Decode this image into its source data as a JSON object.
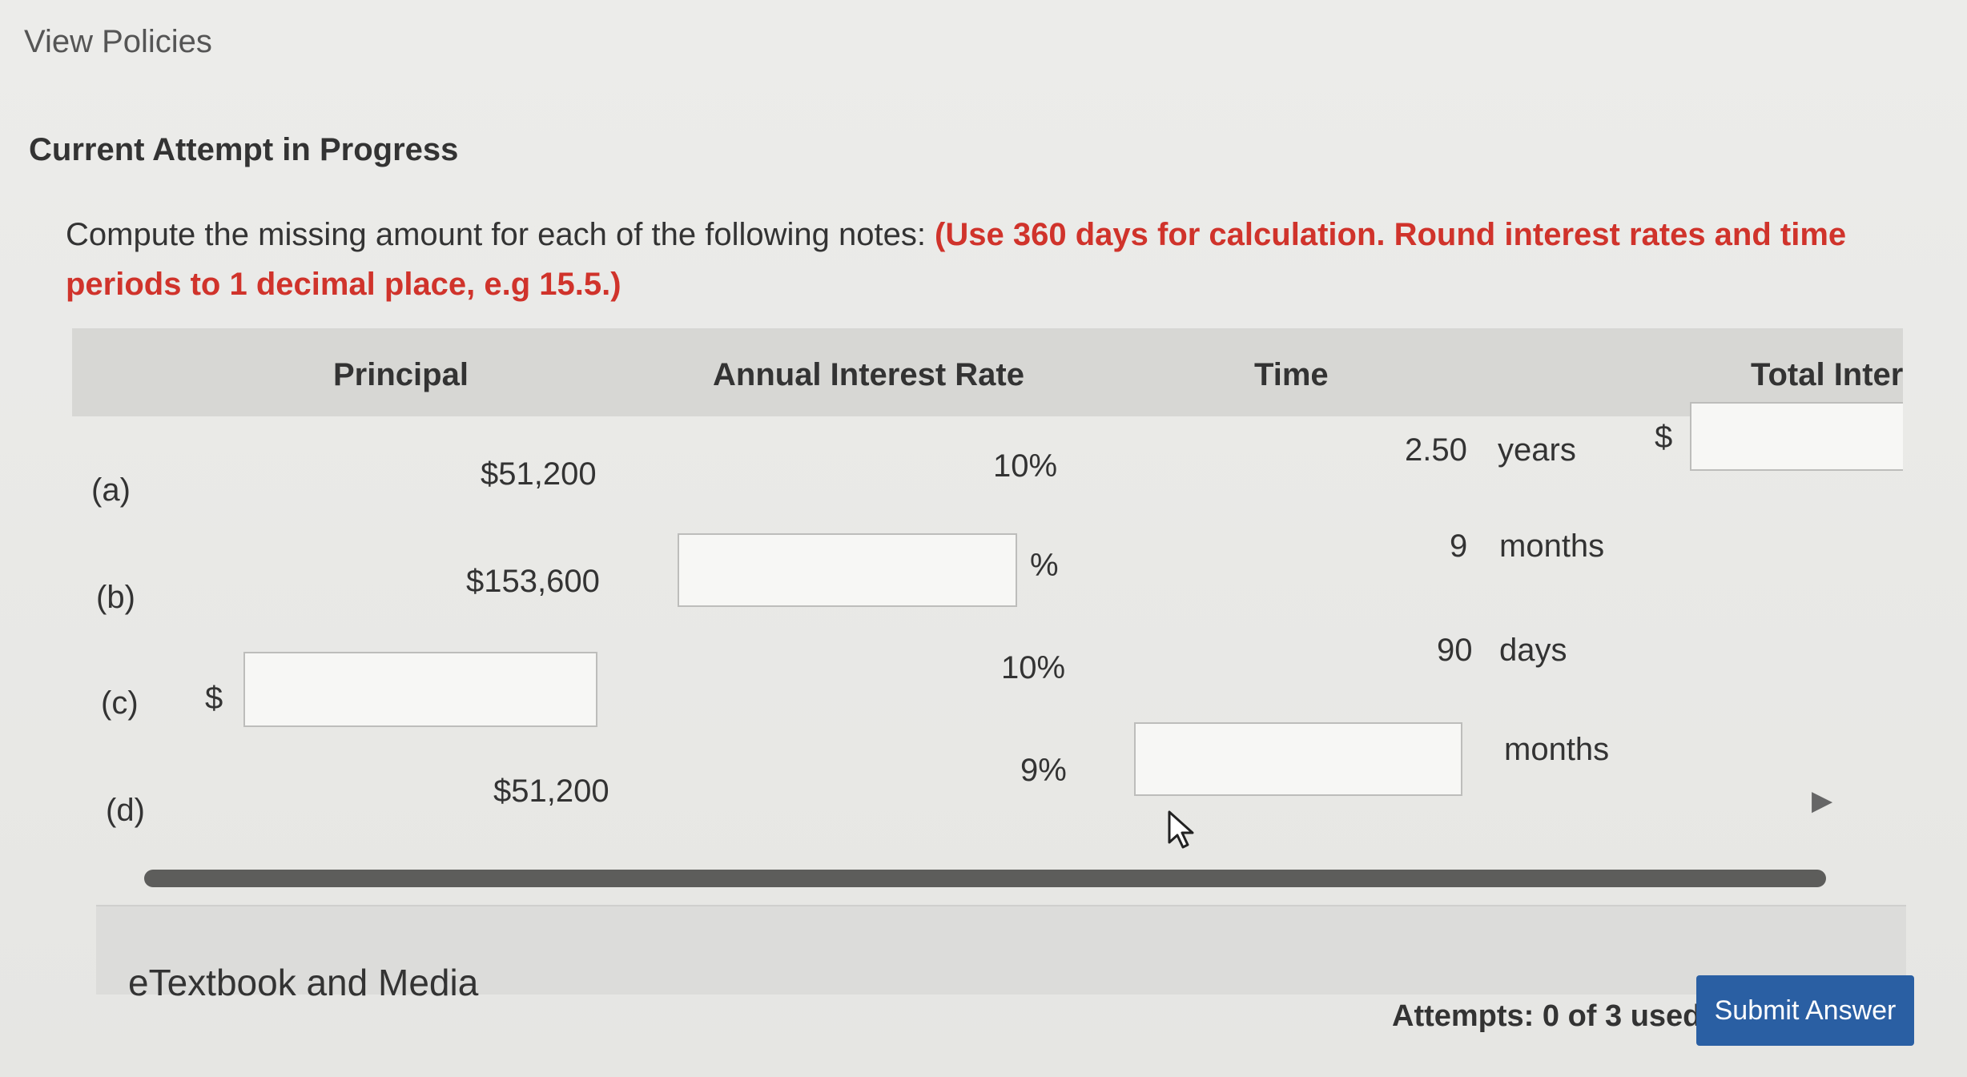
{
  "nav": {
    "view_policies": "View Policies"
  },
  "attempt": {
    "heading": "Current Attempt in Progress"
  },
  "question": {
    "prompt": "Compute the missing amount for each of the following notes: ",
    "note": "(Use 360 days for calculation. Round interest rates and time periods to 1 decimal place, e.g 15.5.)"
  },
  "table": {
    "headers": {
      "principal": "Principal",
      "rate": "Annual Interest Rate",
      "time": "Time",
      "total": "Total Intere"
    },
    "rows": [
      {
        "label": "(a)",
        "principal": "$51,200",
        "rate": "10%",
        "time": "2.50",
        "time_unit": "years",
        "total_prefix": "$"
      },
      {
        "label": "(b)",
        "principal": "$153,600",
        "rate_suffix": "%",
        "time": "9",
        "time_unit": "months"
      },
      {
        "label": "(c)",
        "principal_prefix": "$",
        "rate": "10%",
        "time": "90",
        "time_unit": "days"
      },
      {
        "label": "(d)",
        "principal": "$51,200",
        "rate": "9%",
        "time_unit": "months"
      }
    ]
  },
  "footer": {
    "etextbook": "eTextbook and Media",
    "attempts": "Attempts: 0 of 3 used",
    "submit": "Submit Answer"
  },
  "colors": {
    "accent_button": "#2a5fa3",
    "note_red": "#d0332b",
    "header_bg": "#d7d7d4"
  }
}
